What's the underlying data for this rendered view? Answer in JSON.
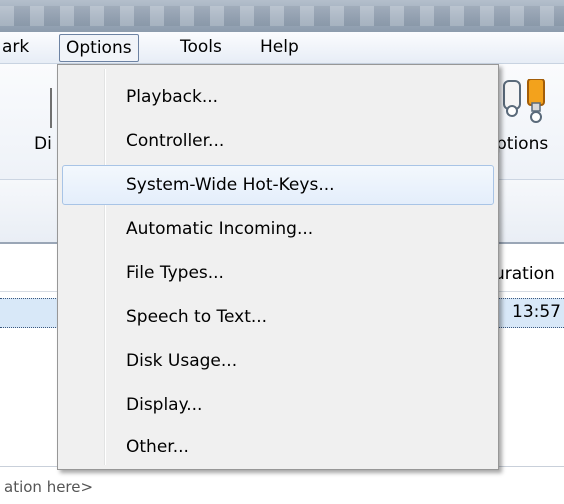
{
  "menubar": {
    "items": [
      {
        "label": "ark"
      },
      {
        "label": "Options"
      },
      {
        "label": "Tools"
      },
      {
        "label": "Help"
      }
    ]
  },
  "toolbar": {
    "left_label": "Di",
    "right_label": "ptions"
  },
  "list": {
    "header_partial": "uration",
    "row_value": "13:57"
  },
  "options_menu": {
    "items": [
      {
        "label": "Playback..."
      },
      {
        "label": "Controller..."
      },
      {
        "label": "System-Wide Hot-Keys...",
        "highlighted": true
      },
      {
        "label": "Automatic Incoming..."
      },
      {
        "label": "File Types..."
      },
      {
        "label": "Speech to Text..."
      },
      {
        "label": "Disk Usage..."
      },
      {
        "label": "Display..."
      },
      {
        "label": "Other..."
      }
    ]
  },
  "footer": {
    "hint": "ation here>"
  },
  "colors": {
    "menu_bg": "#f0f0f0",
    "highlight_border": "#a8c4e6",
    "selected_row": "#d8e8f8"
  }
}
